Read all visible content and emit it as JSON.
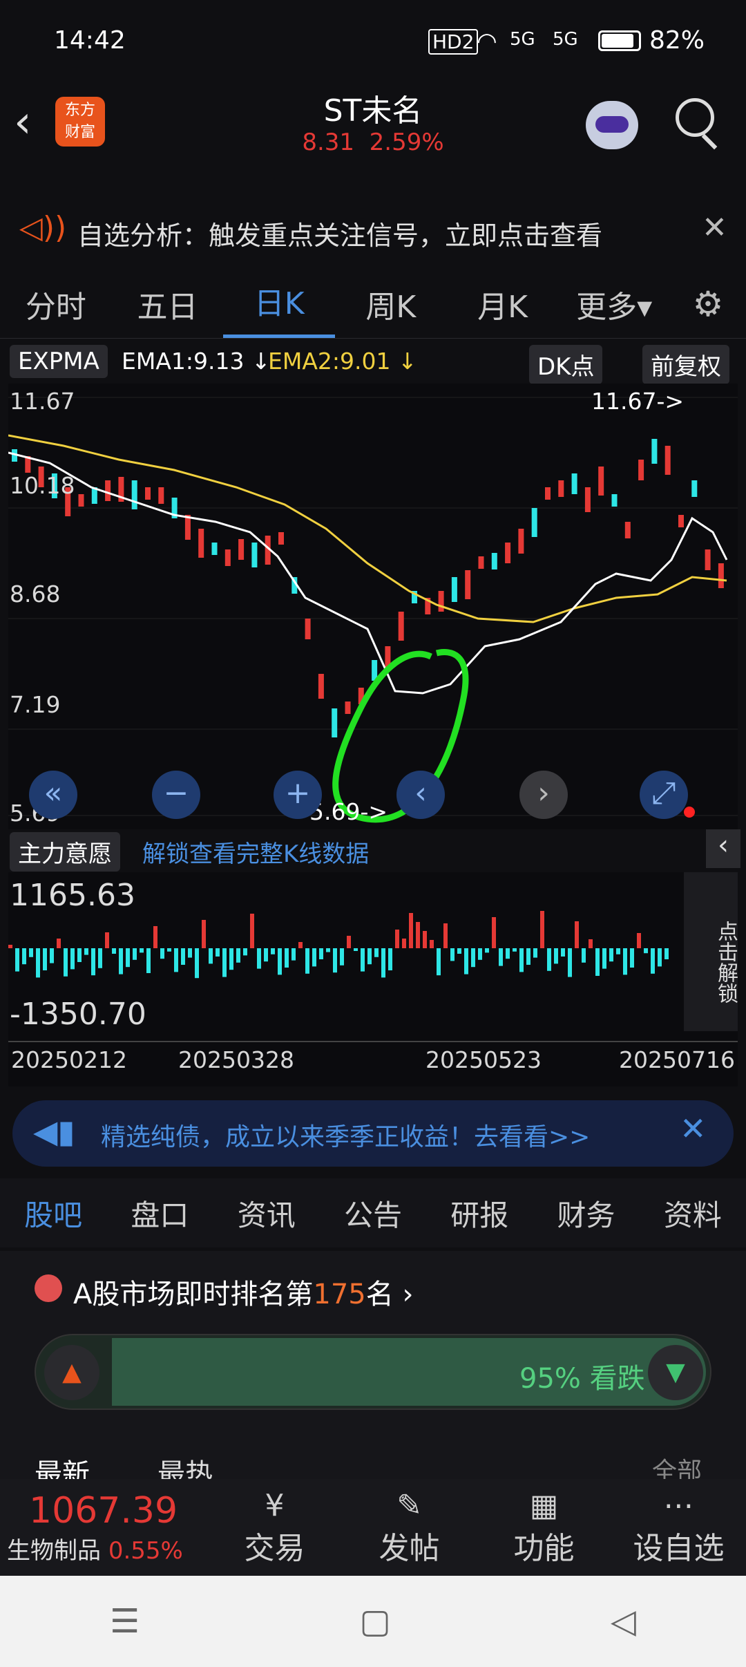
{
  "status": {
    "time": "14:42",
    "battery": "82%",
    "hd": "HD2",
    "net1": "5G",
    "net2": "5G"
  },
  "header": {
    "title": "ST未名",
    "price": "8.31",
    "change": "2.59%",
    "logo_line1": "东方",
    "logo_line2": "财富"
  },
  "notice": {
    "text": "自选分析：触发重点关注信号，立即点击查看"
  },
  "tabs": [
    "分时",
    "五日",
    "日K",
    "周K",
    "月K",
    "更多▾"
  ],
  "indicator": {
    "name": "EXPMA",
    "ema1": "EMA1:9.13 ↓",
    "ema2": "EMA2:9.01 ↓",
    "dk": "DK点",
    "fq": "前复权"
  },
  "price_axis": [
    "11.67",
    "10.18",
    "8.68",
    "7.19",
    "5.69"
  ],
  "markers": {
    "high": "11.67->",
    "low": "5.69->"
  },
  "sub": {
    "name": "主力意愿",
    "unlock": "解锁查看完整K线数据",
    "top": "1165.63",
    "bottom": "-1350.70",
    "side": "点击解锁"
  },
  "dates": [
    "20250212",
    "20250328",
    "20250523",
    "20250716"
  ],
  "banner": {
    "text": "精选纯债，成立以来季季正收益！去看看>>"
  },
  "subtabs": [
    "股吧",
    "盘口",
    "资讯",
    "公告",
    "研报",
    "财务",
    "资料"
  ],
  "ranking": {
    "prefix": "A股市场即时排名第",
    "rank": "175",
    "suffix": "名"
  },
  "sentiment": {
    "text": "95% 看跌"
  },
  "feed": {
    "latest": "最新",
    "hot": "最热",
    "all": "全部"
  },
  "bottom": {
    "index_value": "1067.39",
    "index_name": "生物制品",
    "index_change": "0.55%",
    "trade": "交易",
    "post": "发帖",
    "func": "功能",
    "watch": "设自选"
  }
}
